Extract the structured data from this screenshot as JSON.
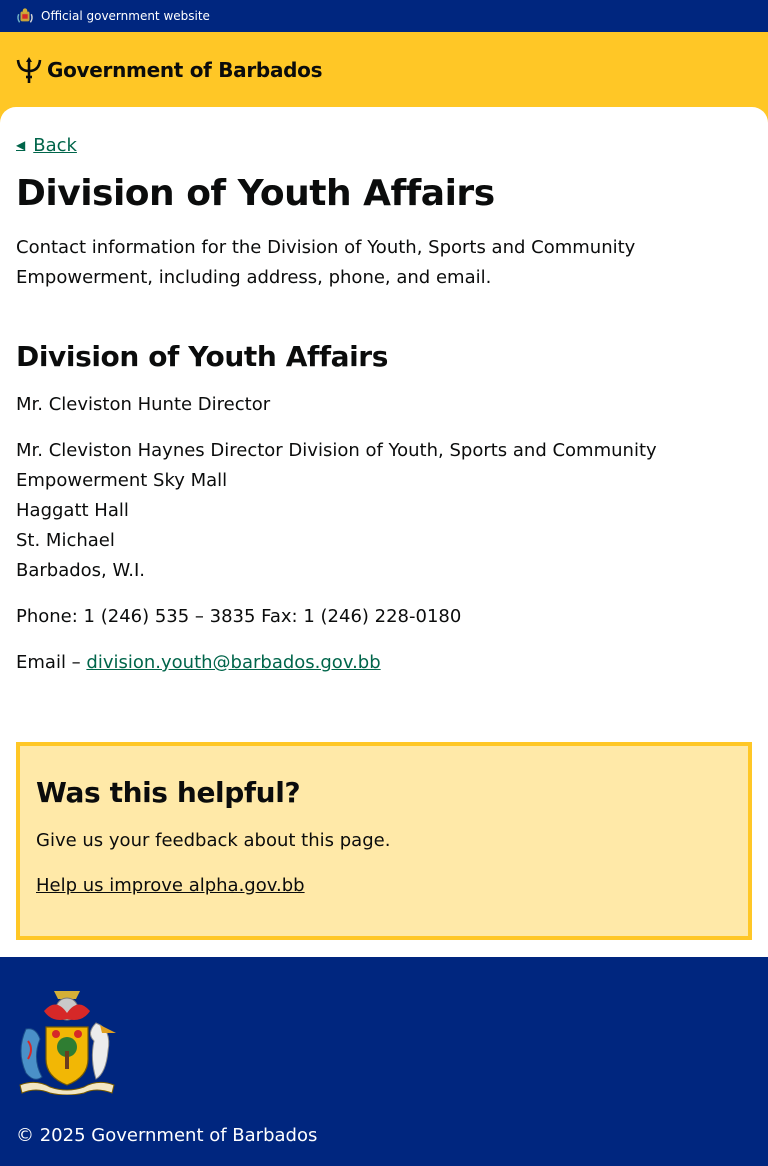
{
  "topbar": {
    "official_label": "Official government website"
  },
  "header": {
    "title": "Government of Barbados"
  },
  "nav": {
    "back_label": "Back"
  },
  "page": {
    "title": "Division of Youth Affairs",
    "lede": "Contact information for the Division of Youth, Sports and Community Empowerment, including address, phone, and email."
  },
  "contact": {
    "heading": "Division of Youth Affairs",
    "director_line": "Mr. Cleviston Hunte Director",
    "address_lines": [
      "Mr. Cleviston Haynes Director Division of Youth, Sports and Community Empowerment Sky Mall",
      "Haggatt Hall",
      "St. Michael",
      "Barbados, W.I."
    ],
    "phone_line": "Phone: 1 (246) 535 – 3835 Fax: 1 (246) 228-0180",
    "email_prefix": "Email – ",
    "email": "division.youth@barbados.gov.bb"
  },
  "feedback": {
    "heading": "Was this helpful?",
    "text": "Give us your feedback about this page.",
    "link_label": "Help us improve alpha.gov.bb"
  },
  "footer": {
    "copyright": "© 2025 Government of Barbados"
  },
  "colors": {
    "navy": "#00267f",
    "gold": "#ffc726",
    "link_green": "#00654a",
    "feedback_bg": "#ffe9a8"
  }
}
